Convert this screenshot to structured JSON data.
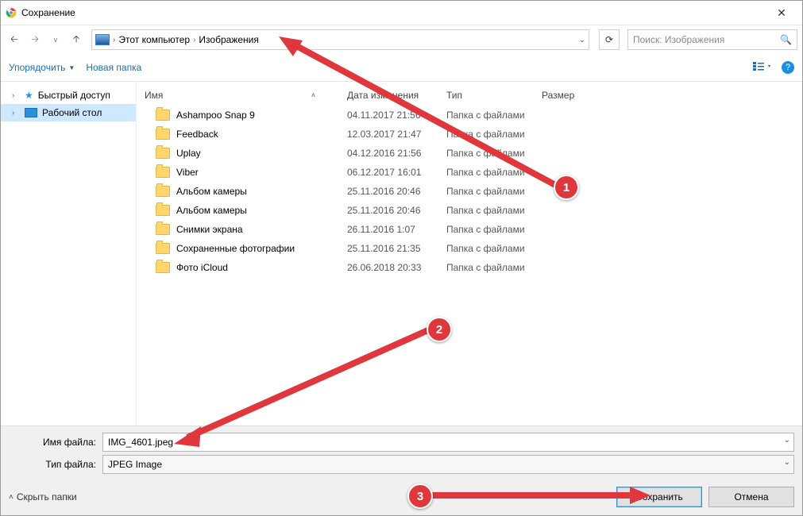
{
  "window": {
    "title": "Сохранение"
  },
  "nav": {
    "breadcrumb": [
      "Этот компьютер",
      "Изображения"
    ],
    "search_placeholder": "Поиск: Изображения"
  },
  "toolbar": {
    "organize": "Упорядочить",
    "new_folder": "Новая папка"
  },
  "sidebar": {
    "quick_access": "Быстрый доступ",
    "desktop": "Рабочий стол"
  },
  "columns": {
    "name": "Имя",
    "date": "Дата изменения",
    "type": "Тип",
    "size": "Размер"
  },
  "type_label": "Папка с файлами",
  "rows": [
    {
      "name": "Ashampoo Snap 9",
      "date": "04.11.2017 21:56"
    },
    {
      "name": "Feedback",
      "date": "12.03.2017 21:47"
    },
    {
      "name": "Uplay",
      "date": "04.12.2016 21:56"
    },
    {
      "name": "Viber",
      "date": "06.12.2017 16:01"
    },
    {
      "name": "Альбом камеры",
      "date": "25.11.2016 20:46"
    },
    {
      "name": "Альбом камеры",
      "date": "25.11.2016 20:46"
    },
    {
      "name": "Снимки экрана",
      "date": "26.11.2016 1:07"
    },
    {
      "name": "Сохраненные фотографии",
      "date": "25.11.2016 21:35"
    },
    {
      "name": "Фото iCloud",
      "date": "26.06.2018 20:33"
    }
  ],
  "fields": {
    "filename_label": "Имя файла:",
    "filename_value": "IMG_4601.jpeg",
    "filetype_label": "Тип файла:",
    "filetype_value": "JPEG Image"
  },
  "actions": {
    "hide_folders": "Скрыть папки",
    "save": "Сохранить",
    "cancel": "Отмена"
  },
  "annotations": {
    "b1": "1",
    "b2": "2",
    "b3": "3"
  }
}
